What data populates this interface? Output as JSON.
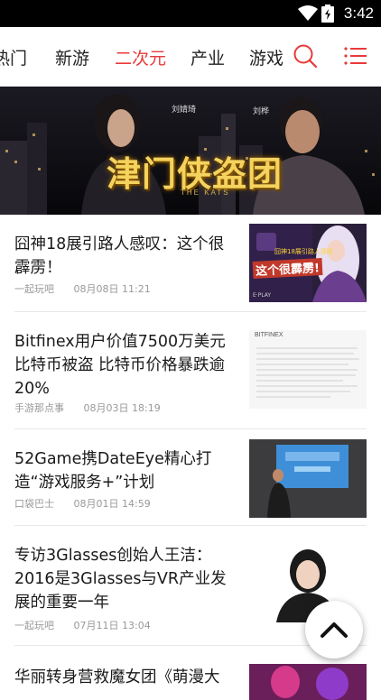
{
  "status_bar": {
    "time": "3:42"
  },
  "tabs": [
    {
      "label": "热门"
    },
    {
      "label": "新游"
    },
    {
      "label": "二次元",
      "active": true
    },
    {
      "label": "产业"
    },
    {
      "label": "游戏"
    }
  ],
  "banner": {
    "headline": "津门侠盗团",
    "subtitle": "THE KATS",
    "names": [
      "刘婧琦",
      "刘桦"
    ]
  },
  "articles": [
    {
      "title": "囧神18展引路人感叹：这个很霹雳！",
      "source": "一起玩吧",
      "time": "08月08日 11:21",
      "thumb_text": "这个很霹雳!",
      "thumb_small": "囧神18展引路人感叹",
      "thumb_footer": "E·PLAY"
    },
    {
      "title": "Bitfinex用户价值7500万美元比特币被盗 比特币价格暴跌逾20%",
      "source": "手游那点事",
      "time": "08月03日 18:19",
      "thumb_text": "BITFINEX"
    },
    {
      "title": "52Game携DateEye精心打造“游戏服务+”计划",
      "source": "口袋巴士",
      "time": "08月01日 14:59"
    },
    {
      "title": "专访3Glasses创始人王洁：2016是3Glasses与VR产业发展的重要一年",
      "source": "一起玩吧",
      "time": "07月11日 13:04"
    },
    {
      "title": "华丽转身营救魔女团《萌漫大",
      "source": "",
      "time": ""
    }
  ],
  "icons": {
    "search": "search-icon",
    "menu": "menu-icon",
    "back_to_top": "chevron-up-icon"
  },
  "colors": {
    "accent": "#e83a3a"
  }
}
